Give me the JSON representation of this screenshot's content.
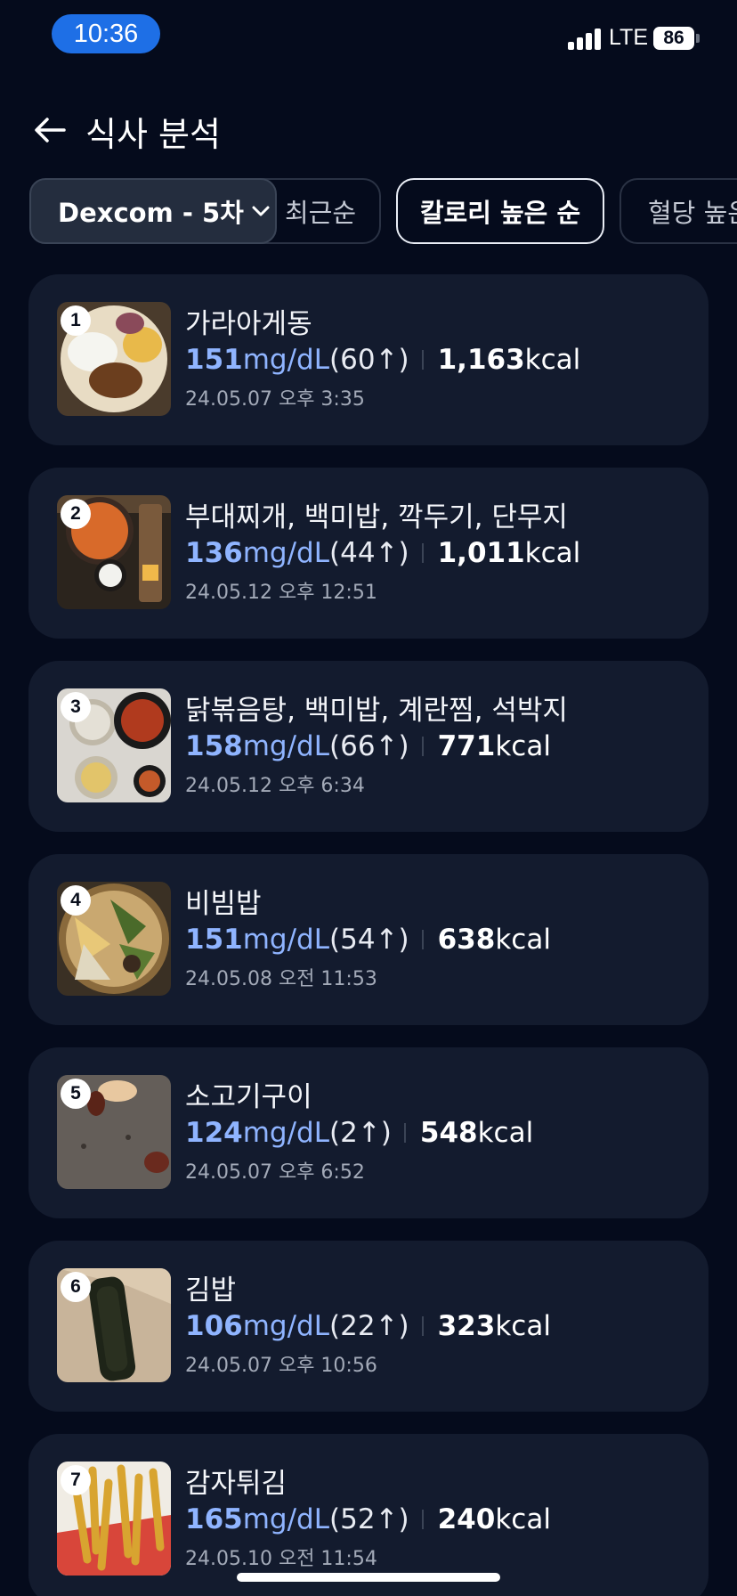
{
  "status_bar": {
    "time": "10:36",
    "network": "LTE",
    "battery": "86"
  },
  "header": {
    "title": "식사 분석"
  },
  "filters": {
    "device": "Dexcom - 5차",
    "sort_options": [
      "최근순",
      "칼로리 높은 순",
      "혈당 높은 순"
    ],
    "active_sort": "칼로리 높은 순"
  },
  "meals": [
    {
      "rank": "1",
      "name": "가라아게동",
      "glucose": "151",
      "glucose_unit": "mg/dL",
      "delta": "(60↑)",
      "kcal": "1,163",
      "kcal_unit": "kcal",
      "datetime": "24.05.07 오후 3:35"
    },
    {
      "rank": "2",
      "name": "부대찌개, 백미밥, 깍두기, 단무지",
      "glucose": "136",
      "glucose_unit": "mg/dL",
      "delta": "(44↑)",
      "kcal": "1,011",
      "kcal_unit": "kcal",
      "datetime": "24.05.12 오후 12:51"
    },
    {
      "rank": "3",
      "name": "닭볶음탕, 백미밥, 계란찜, 석박지",
      "glucose": "158",
      "glucose_unit": "mg/dL",
      "delta": "(66↑)",
      "kcal": "771",
      "kcal_unit": "kcal",
      "datetime": "24.05.12 오후 6:34"
    },
    {
      "rank": "4",
      "name": "비빔밥",
      "glucose": "151",
      "glucose_unit": "mg/dL",
      "delta": "(54↑)",
      "kcal": "638",
      "kcal_unit": "kcal",
      "datetime": "24.05.08 오전 11:53"
    },
    {
      "rank": "5",
      "name": "소고기구이",
      "glucose": "124",
      "glucose_unit": "mg/dL",
      "delta": "(2↑)",
      "kcal": "548",
      "kcal_unit": "kcal",
      "datetime": "24.05.07 오후 6:52"
    },
    {
      "rank": "6",
      "name": "김밥",
      "glucose": "106",
      "glucose_unit": "mg/dL",
      "delta": "(22↑)",
      "kcal": "323",
      "kcal_unit": "kcal",
      "datetime": "24.05.07 오후 10:56"
    },
    {
      "rank": "7",
      "name": "감자튀김",
      "glucose": "165",
      "glucose_unit": "mg/dL",
      "delta": "(52↑)",
      "kcal": "240",
      "kcal_unit": "kcal",
      "datetime": "24.05.10 오전 11:54"
    }
  ],
  "colors": {
    "background": "#050b1c",
    "card": "#131b2e",
    "glucose_accent": "#8fb4ff",
    "time_pill": "#1e6fe6"
  }
}
